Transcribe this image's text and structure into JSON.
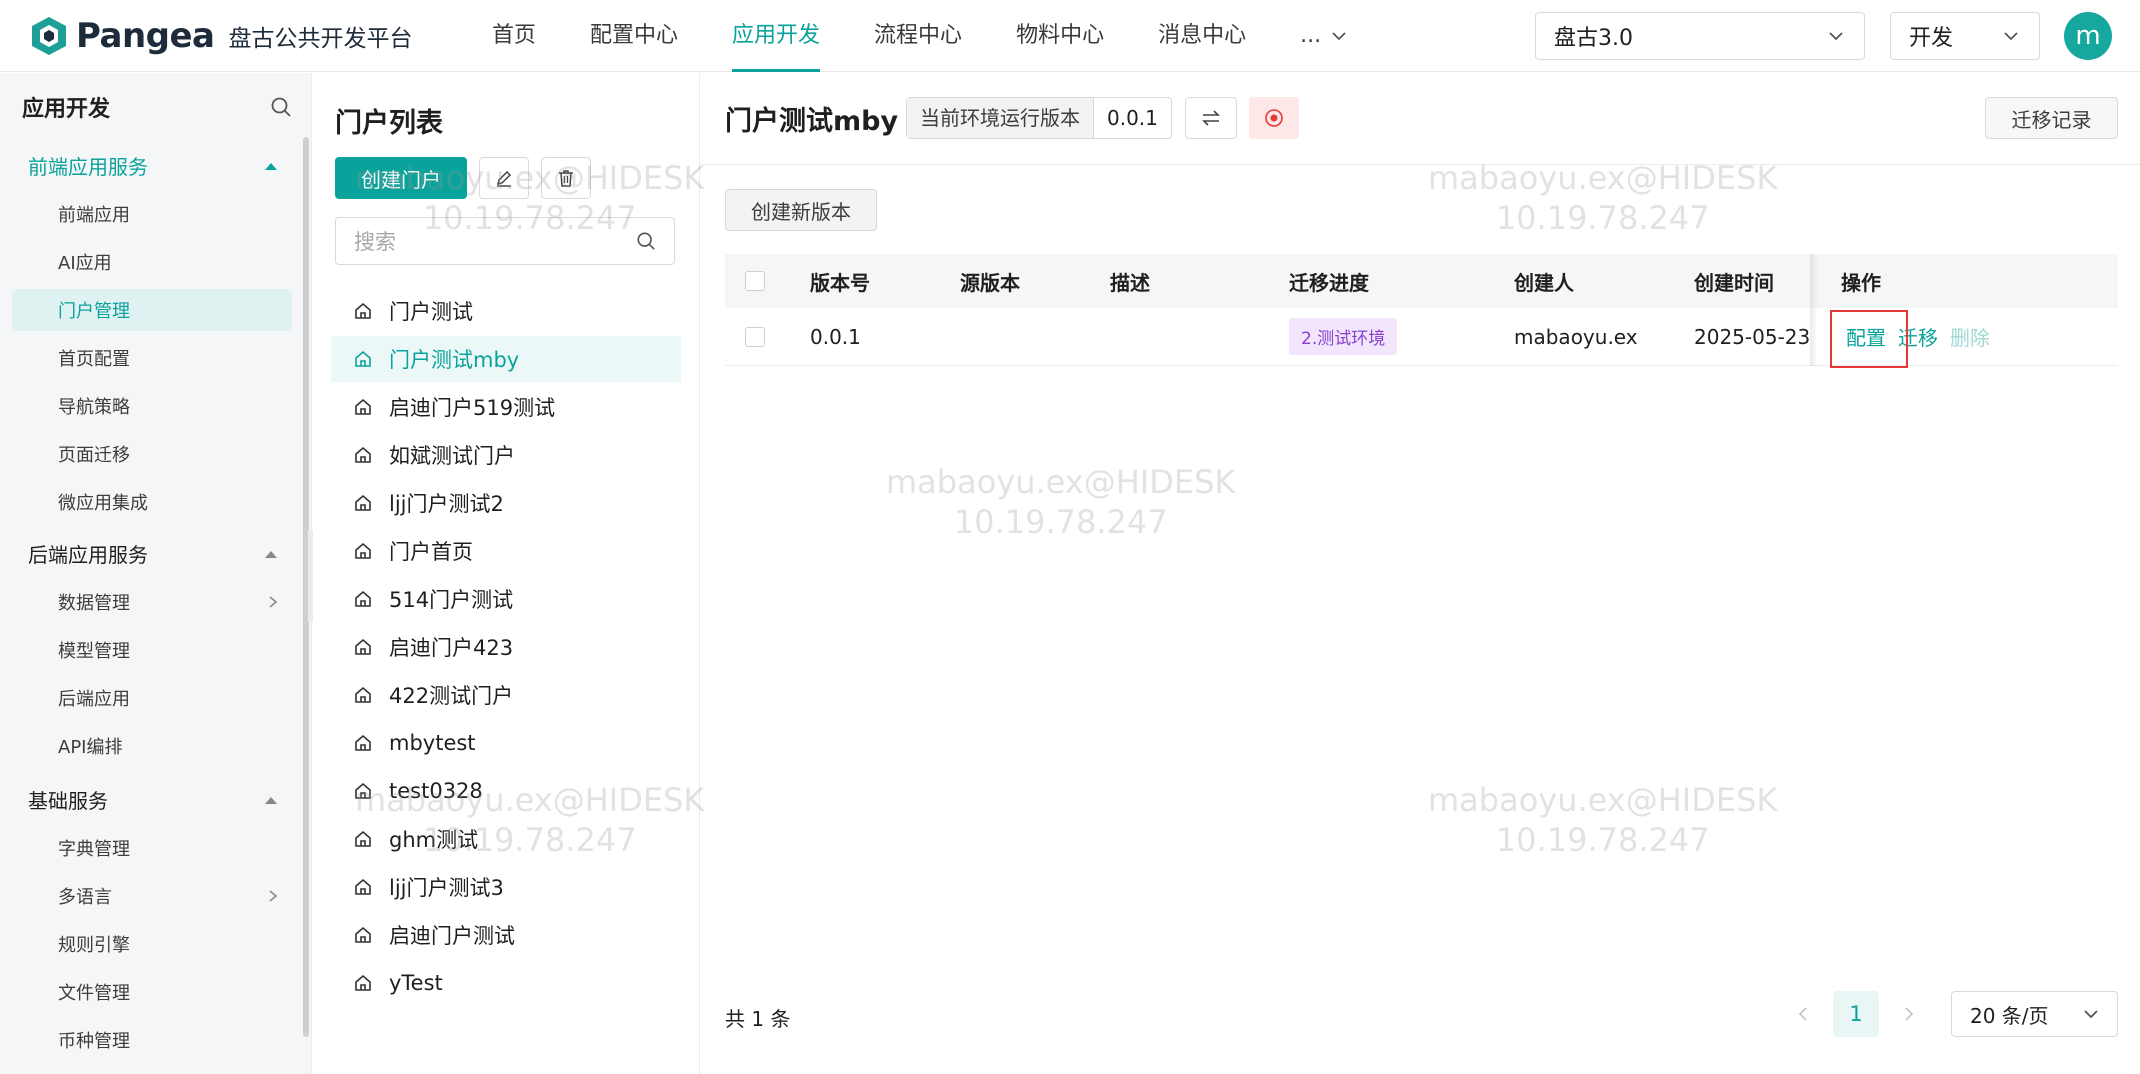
{
  "header": {
    "brand": "Pangea",
    "platform_name": "盘古公共开发平台",
    "nav": [
      {
        "label": "首页",
        "active": false
      },
      {
        "label": "配置中心",
        "active": false
      },
      {
        "label": "应用开发",
        "active": true
      },
      {
        "label": "流程中心",
        "active": false
      },
      {
        "label": "物料中心",
        "active": false
      },
      {
        "label": "消息中心",
        "active": false
      }
    ],
    "nav_more": "...",
    "platform_select": "盘古3.0",
    "env_select": "开发",
    "avatar_letter": "m"
  },
  "sidebar": {
    "title": "应用开发",
    "groups": [
      {
        "label": "前端应用服务",
        "open": true,
        "items": [
          {
            "label": "前端应用",
            "active": false
          },
          {
            "label": "AI应用",
            "active": false
          },
          {
            "label": "门户管理",
            "active": true
          },
          {
            "label": "首页配置",
            "active": false
          },
          {
            "label": "导航策略",
            "active": false
          },
          {
            "label": "页面迁移",
            "active": false
          },
          {
            "label": "微应用集成",
            "active": false
          }
        ]
      },
      {
        "label": "后端应用服务",
        "open": false,
        "items": [
          {
            "label": "数据管理",
            "active": false,
            "has_children": true
          },
          {
            "label": "模型管理",
            "active": false
          },
          {
            "label": "后端应用",
            "active": false
          },
          {
            "label": "API编排",
            "active": false
          }
        ]
      },
      {
        "label": "基础服务",
        "open": false,
        "items": [
          {
            "label": "字典管理",
            "active": false
          },
          {
            "label": "多语言",
            "active": false,
            "has_children": true
          },
          {
            "label": "规则引擎",
            "active": false
          },
          {
            "label": "文件管理",
            "active": false
          },
          {
            "label": "币种管理",
            "active": false
          }
        ]
      }
    ]
  },
  "portal_list": {
    "title": "门户列表",
    "create_label": "创建门户",
    "search_placeholder": "搜索",
    "items": [
      "门户测试",
      "门户测试mby",
      "启迪门户519测试",
      "如斌测试门户",
      "ljj门户测试2",
      "门户首页",
      "514门户测试",
      "启迪门户423",
      "422测试门户",
      "mbytest",
      "test0328",
      "ghm测试",
      "ljj门户测试3",
      "启迪门户测试",
      "yTest"
    ],
    "active_index": 1
  },
  "main": {
    "title": "门户测试mby",
    "env_version_label": "当前环境运行版本",
    "env_version_value": "0.0.1",
    "history_label": "迁移记录",
    "new_version_label": "创建新版本",
    "table": {
      "columns": [
        "版本号",
        "源版本",
        "描述",
        "迁移进度",
        "创建人",
        "创建时间",
        "操作"
      ],
      "rows": [
        {
          "version": "0.0.1",
          "source": "",
          "desc": "",
          "progress": "2.测试环境",
          "creator": "mabaoyu.ex",
          "created": "2025-05-23",
          "actions": {
            "config": "配置",
            "migrate": "迁移",
            "delete": "删除"
          }
        }
      ]
    },
    "total_text": "共 1 条",
    "pagination": {
      "current": "1",
      "page_size": "20 条/页"
    }
  },
  "watermark": {
    "line1": "mabaoyu.ex@HIDESK",
    "line2": "10.19.78.247"
  },
  "colors": {
    "accent": "#0aa39b",
    "tag_purple": "#8a3fd1",
    "highlight_red": "#e53935"
  }
}
